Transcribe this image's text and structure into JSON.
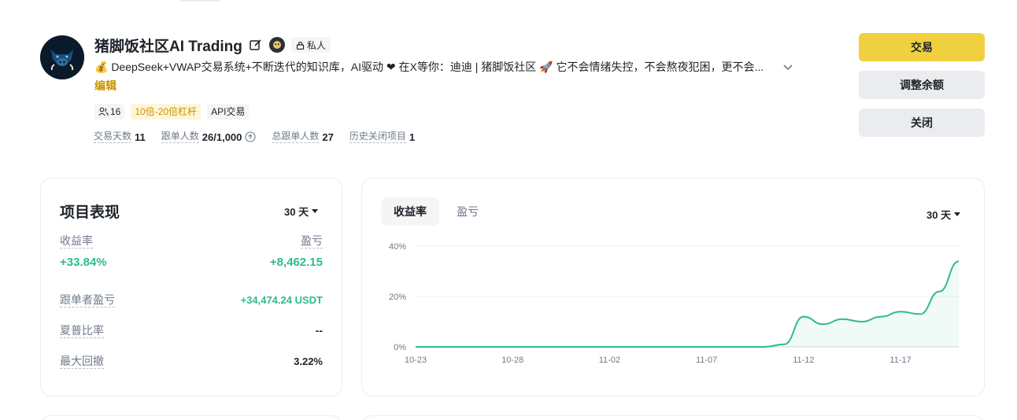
{
  "profile": {
    "title": "猪脚饭社区AI Trading",
    "private_label": "私人",
    "description": "💰 DeepSeek+VWAP交易系统+不断迭代的知识库，AI驱动 ❤ 在X等你：迪迪 | 猪脚饭社区 🚀 它不会情绪失控，不会熬夜犯困，更不会...",
    "edit_link": "编辑",
    "tags": {
      "followers": "16",
      "leverage": "10倍-20倍杠杆",
      "api": "API交易"
    },
    "stats": [
      {
        "label": "交易天数",
        "value": "11"
      },
      {
        "label": "跟单人数",
        "value": "26/1,000"
      },
      {
        "label": "总跟单人数",
        "value": "27"
      },
      {
        "label": "历史关闭项目",
        "value": "1"
      }
    ]
  },
  "actions": {
    "trade": "交易",
    "adjust_balance": "调整余额",
    "close": "关闭"
  },
  "performance": {
    "title": "项目表现",
    "range": "30 天",
    "roi_label": "收益率",
    "roi_value": "+33.84%",
    "pnl_label": "盈亏",
    "pnl_value": "+8,462.15",
    "copier_pnl_label": "跟单者盈亏",
    "copier_pnl_value": "+34,474.24 USDT",
    "sharpe_label": "夏普比率",
    "sharpe_value": "--",
    "mdd_label": "最大回撤",
    "mdd_value": "3.22%"
  },
  "chart_panel": {
    "tabs": [
      "收益率",
      "盈亏"
    ],
    "active_tab": 0,
    "range": "30 天"
  },
  "colors": {
    "accent_yellow": "#f0d03e",
    "positive_green": "#2ebd85",
    "link_gold": "#c99400"
  },
  "chart_data": {
    "type": "line",
    "title": "",
    "xlabel": "",
    "ylabel": "",
    "x_ticks": [
      "10-23",
      "10-28",
      "11-02",
      "11-07",
      "11-12",
      "11-17"
    ],
    "y_ticks": [
      "0%",
      "20%",
      "40%"
    ],
    "ylim": [
      0,
      40
    ],
    "grid": true,
    "series": [
      {
        "values": [
          {
            "x": "10-23",
            "y": 0
          },
          {
            "x": "10-28",
            "y": 0
          },
          {
            "x": "11-02",
            "y": 0
          },
          {
            "x": "11-07",
            "y": 0
          },
          {
            "x": "11-10",
            "y": 0
          },
          {
            "x": "11-11",
            "y": 1
          },
          {
            "x": "11-12",
            "y": 12
          },
          {
            "x": "11-13",
            "y": 9
          },
          {
            "x": "11-14",
            "y": 11
          },
          {
            "x": "11-15",
            "y": 10
          },
          {
            "x": "11-16",
            "y": 12
          },
          {
            "x": "11-17",
            "y": 14
          },
          {
            "x": "11-18",
            "y": 13
          },
          {
            "x": "11-19",
            "y": 22
          },
          {
            "x": "11-20",
            "y": 34
          }
        ]
      }
    ]
  }
}
